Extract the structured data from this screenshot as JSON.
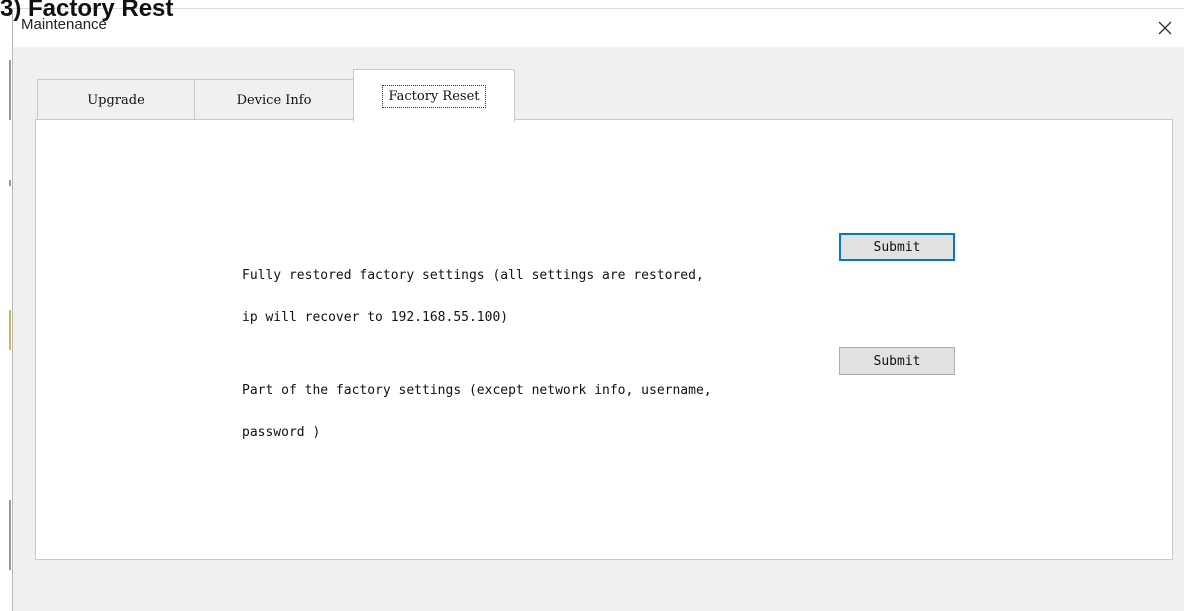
{
  "document": {
    "heading": "3) Factory Rest"
  },
  "window": {
    "title": "Maintenance",
    "close_symbol": "close-icon"
  },
  "tabs": [
    {
      "label": "Upgrade",
      "active": false
    },
    {
      "label": "Device Info",
      "active": false
    },
    {
      "label": "Factory Reset",
      "active": true
    }
  ],
  "factory_reset": {
    "full_reset": {
      "line1": "Fully restored factory settings (all settings are restored,",
      "line2": "ip will recover to 192.168.55.100)",
      "button_label": "Submit"
    },
    "partial_reset": {
      "line1": "Part of the factory settings (except network info, username,",
      "line2": "password )",
      "button_label": "Submit"
    }
  },
  "colors": {
    "default_button_border": "#0078d7",
    "button_face": "#e1e1e1",
    "window_background": "#f0f0f0"
  }
}
